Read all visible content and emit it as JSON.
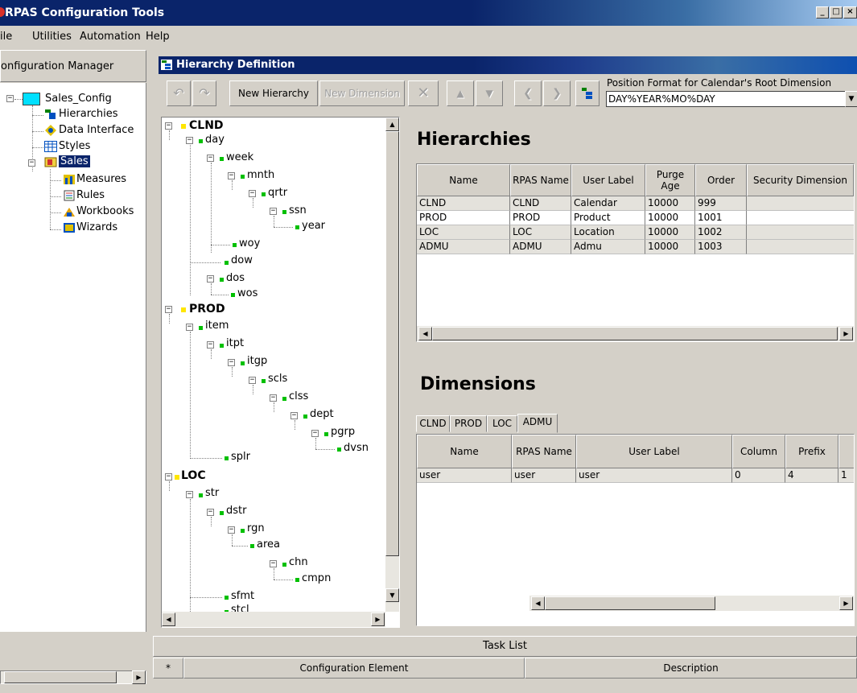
{
  "window": {
    "title": "RPAS Configuration Tools",
    "minimize": "_",
    "maximize": "□"
  },
  "menu": [
    "ile",
    "Utilities",
    "Automation",
    "Help"
  ],
  "config_manager": {
    "header": "onfiguration Manager",
    "root": "Sales_Config",
    "items": [
      {
        "label": "Hierarchies",
        "icon": "hierarchy-icon"
      },
      {
        "label": "Data Interface",
        "icon": "data-interface-icon"
      },
      {
        "label": "Styles",
        "icon": "grid-icon"
      },
      {
        "label": "Sales",
        "icon": "folder-icon",
        "selected": true
      }
    ],
    "sales_children": [
      {
        "label": "Measures",
        "icon": "measures-icon"
      },
      {
        "label": "Rules",
        "icon": "rules-icon"
      },
      {
        "label": "Workbooks",
        "icon": "workbooks-icon"
      },
      {
        "label": "Wizards",
        "icon": "wizards-icon"
      }
    ]
  },
  "hierarchy_definition": {
    "title": "Hierarchy Definition",
    "toolbar": {
      "new_hierarchy": "New Hierarchy",
      "new_dimension": "New Dimension",
      "position_label": "Position Format for Calendar's Root Dimension",
      "position_value": "DAY%YEAR%MO%DAY"
    }
  },
  "tree": {
    "clnd": "CLND",
    "day": "day",
    "week": "week",
    "mnth": "mnth",
    "qrtr": "qrtr",
    "ssn": "ssn",
    "year": "year",
    "woy": "woy",
    "dow": "dow",
    "dos": "dos",
    "wos": "wos",
    "prod": "PROD",
    "item": "item",
    "itpt": "itpt",
    "itgp": "itgp",
    "scls": "scls",
    "clss": "clss",
    "dept": "dept",
    "pgrp": "pgrp",
    "dvsn": "dvsn",
    "splr": "splr",
    "loc": "LOC",
    "str": "str",
    "dstr": "dstr",
    "rgn": "rgn",
    "area": "area",
    "chn": "chn",
    "cmpn": "cmpn",
    "sfmt": "sfmt",
    "stcl": "stcl"
  },
  "hierarchies": {
    "title": "Hierarchies",
    "columns": [
      "Name",
      "RPAS Name",
      "User Label",
      "Purge Age",
      "Order",
      "Security Dimension"
    ],
    "rows": [
      [
        "CLND",
        "CLND",
        "Calendar",
        "10000",
        "999",
        ""
      ],
      [
        "PROD",
        "PROD",
        "Product",
        "10000",
        "1001",
        ""
      ],
      [
        "LOC",
        "LOC",
        "Location",
        "10000",
        "1002",
        ""
      ],
      [
        "ADMU",
        "ADMU",
        "Admu",
        "10000",
        "1003",
        ""
      ]
    ]
  },
  "dimensions": {
    "title": "Dimensions",
    "tabs": [
      "CLND",
      "PROD",
      "LOC",
      "ADMU"
    ],
    "active_tab": "ADMU",
    "columns": [
      "Name",
      "RPAS Name",
      "User Label",
      "Column",
      "Prefix"
    ],
    "rows": [
      [
        "user",
        "user",
        "user",
        "0",
        "4",
        "1"
      ]
    ]
  },
  "task_list": {
    "title": "Task List",
    "columns": [
      "*",
      "Configuration Element",
      "Description"
    ]
  }
}
